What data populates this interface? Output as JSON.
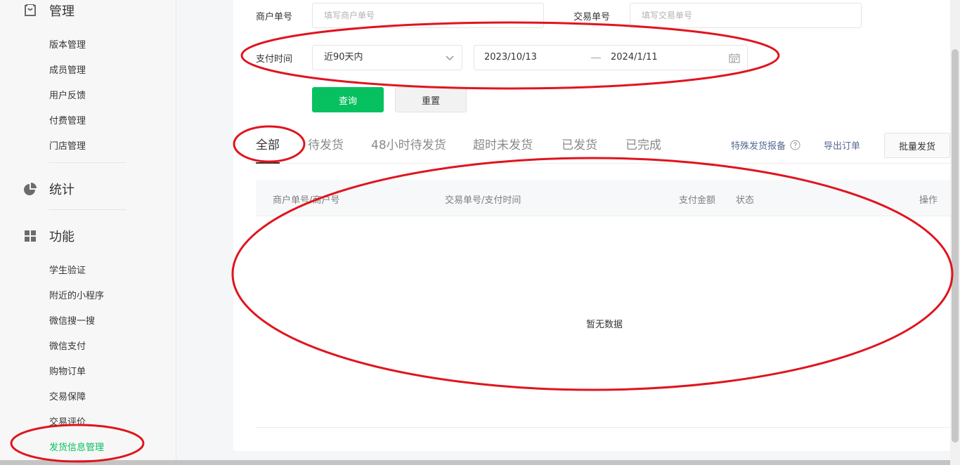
{
  "sidebar": {
    "sections": [
      {
        "title": "管理",
        "icon": "store-icon",
        "items": [
          "版本管理",
          "成员管理",
          "用户反馈",
          "付费管理",
          "门店管理"
        ]
      },
      {
        "title": "统计",
        "icon": "pie-chart-icon",
        "items": []
      },
      {
        "title": "功能",
        "icon": "grid-icon",
        "items": [
          "学生验证",
          "附近的小程序",
          "微信搜一搜",
          "微信支付",
          "购物订单",
          "交易保障",
          "交易评价",
          "发货信息管理"
        ]
      }
    ],
    "active_item": "发货信息管理"
  },
  "filters": {
    "merchant_no_label": "商户单号",
    "merchant_no_placeholder": "填写商户单号",
    "trade_no_label": "交易单号",
    "trade_no_placeholder": "填写交易单号",
    "pay_time_label": "支付时间",
    "pay_time_range": "近90天内",
    "date_start": "2023/10/13",
    "date_end": "2024/1/11",
    "query_button": "查询",
    "reset_button": "重置"
  },
  "tabs": [
    "全部",
    "待发货",
    "48小时待发货",
    "超时未发货",
    "已发货",
    "已完成"
  ],
  "active_tab": "全部",
  "actions": {
    "special_report": "特殊发货报备",
    "export_orders": "导出订单",
    "batch_ship": "批量发货"
  },
  "table": {
    "columns": [
      "商户单号/商户号",
      "交易单号/支付时间",
      "支付金额",
      "状态",
      "操作"
    ],
    "empty_text": "暂无数据"
  },
  "colors": {
    "brand_green": "#07c160",
    "link_blue": "#576b95",
    "annotation_red": "#e0141e"
  }
}
